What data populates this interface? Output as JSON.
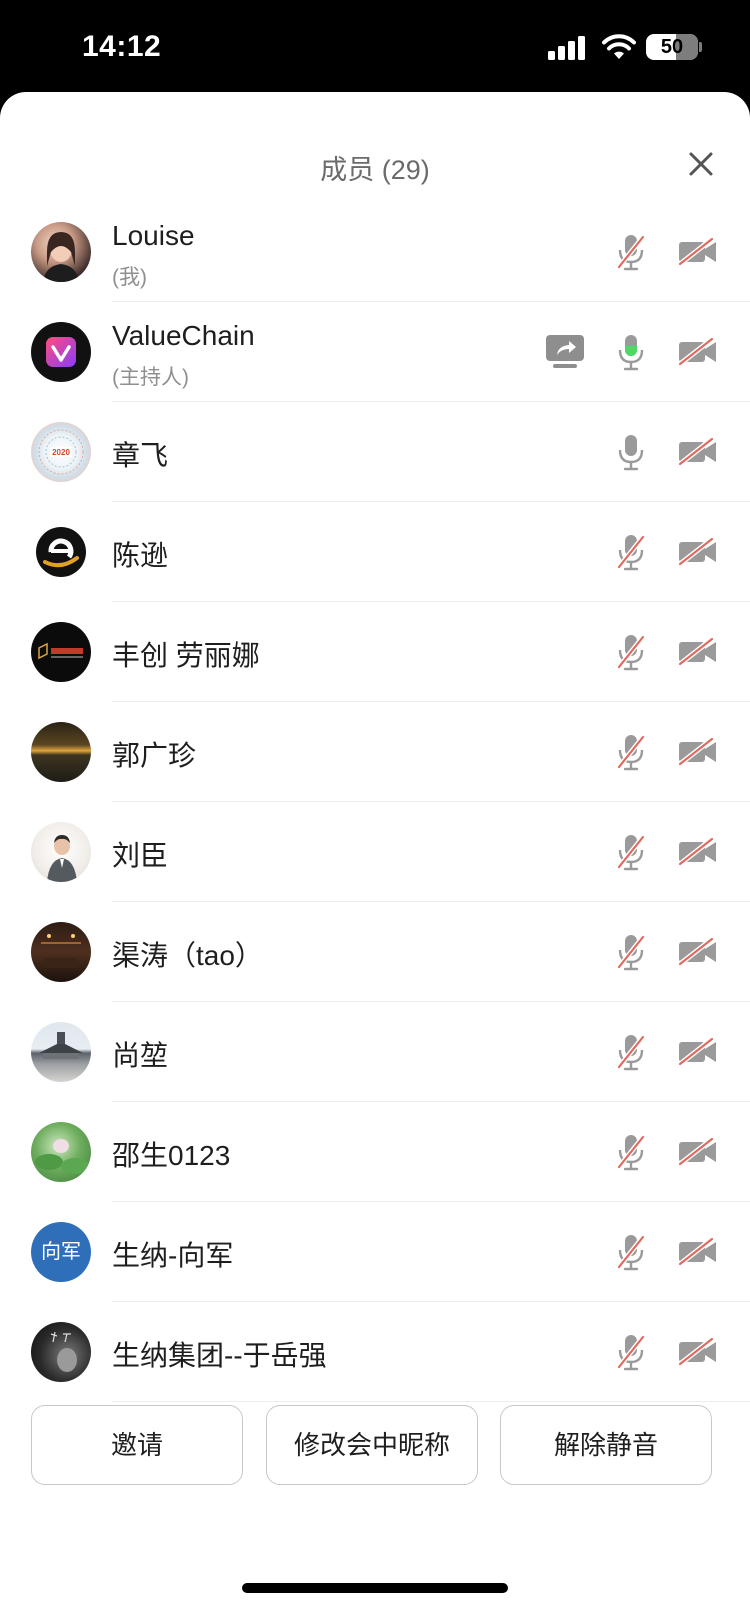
{
  "status": {
    "time": "14:12",
    "battery": "50"
  },
  "sheet": {
    "title": "成员 (29)"
  },
  "members": [
    {
      "name": "Louise",
      "subtitle": "(我)",
      "mic": "muted",
      "camera": "off",
      "avatar": "photo-woman"
    },
    {
      "name": "ValueChain",
      "subtitle": "(主持人)",
      "mic": "active",
      "camera": "off",
      "sharing": true,
      "avatar": "logo-v"
    },
    {
      "name": "章飞",
      "subtitle": "",
      "mic": "unmuted",
      "camera": "off",
      "avatar": "logo-2020",
      "avatar_text": "2020"
    },
    {
      "name": "陈逊",
      "subtitle": "",
      "mic": "muted",
      "camera": "off",
      "avatar": "logo-e"
    },
    {
      "name": "丰创 劳丽娜",
      "subtitle": "",
      "mic": "muted",
      "camera": "off",
      "avatar": "logo-fc"
    },
    {
      "name": "郭广珍",
      "subtitle": "",
      "mic": "muted",
      "camera": "off",
      "avatar": "photo-sunset"
    },
    {
      "name": "刘臣",
      "subtitle": "",
      "mic": "muted",
      "camera": "off",
      "avatar": "photo-man"
    },
    {
      "name": "渠涛（tao）",
      "subtitle": "",
      "mic": "muted",
      "camera": "off",
      "avatar": "photo-night"
    },
    {
      "name": "尚堃",
      "subtitle": "",
      "mic": "muted",
      "camera": "off",
      "avatar": "photo-temple"
    },
    {
      "name": "邵生0123",
      "subtitle": "",
      "mic": "muted",
      "camera": "off",
      "avatar": "photo-lotus"
    },
    {
      "name": "生纳-向军",
      "subtitle": "",
      "mic": "muted",
      "camera": "off",
      "avatar": "text",
      "avatar_text": "向军"
    },
    {
      "name": "生纳集团--于岳强",
      "subtitle": "",
      "mic": "muted",
      "camera": "off",
      "avatar": "photo-bw"
    }
  ],
  "buttons": {
    "invite": "邀请",
    "rename": "修改会中昵称",
    "unmute": "解除静音"
  },
  "colors": {
    "muted_slash": "#e06a5f",
    "active_mic": "#4cd964",
    "icon_gray": "#9a9a9a"
  }
}
